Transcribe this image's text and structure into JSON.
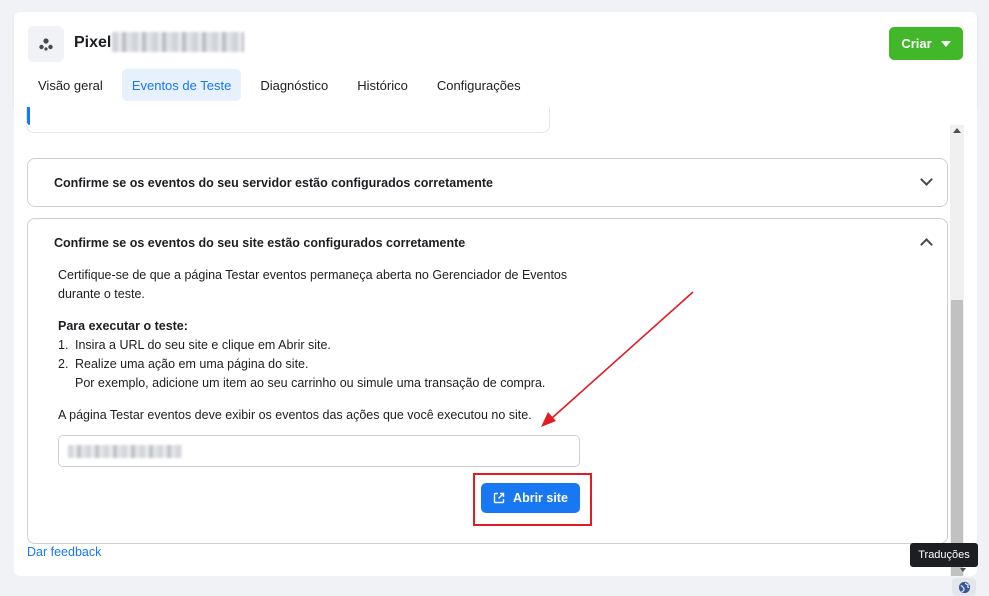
{
  "header": {
    "pixel_label": "Pixel",
    "create_label": "Criar"
  },
  "tabs": [
    {
      "label": "Visão geral",
      "active": false
    },
    {
      "label": "Eventos de Teste",
      "active": true
    },
    {
      "label": "Diagnóstico",
      "active": false
    },
    {
      "label": "Histórico",
      "active": false
    },
    {
      "label": "Configurações",
      "active": false
    }
  ],
  "sections": {
    "server": {
      "title": "Confirme se os eventos do seu servidor estão configurados corretamente",
      "expanded": false
    },
    "website": {
      "title": "Confirme se os eventos do seu site estão configurados corretamente",
      "expanded": true,
      "intro": "Certifique-se de que a página Testar eventos permaneça aberta no Gerenciador de Eventos durante o teste.",
      "steps_title": "Para executar o teste:",
      "steps": [
        {
          "num": "1.",
          "text": "Insira a URL do seu site e clique em Abrir site."
        },
        {
          "num": "2.",
          "text": "Realize uma ação em uma página do site.",
          "extra": "Por exemplo, adicione um item ao seu carrinho ou simule uma transação de compra."
        }
      ],
      "note": "A página Testar eventos deve exibir os eventos das ações que você executou no site.",
      "open_site_label": "Abrir site"
    }
  },
  "feedback_label": "Dar feedback",
  "tooltip_label": "Traduções",
  "colors": {
    "create_button": "#42b72a",
    "primary_blue": "#1877f2",
    "annotation_red": "#e11c24"
  }
}
